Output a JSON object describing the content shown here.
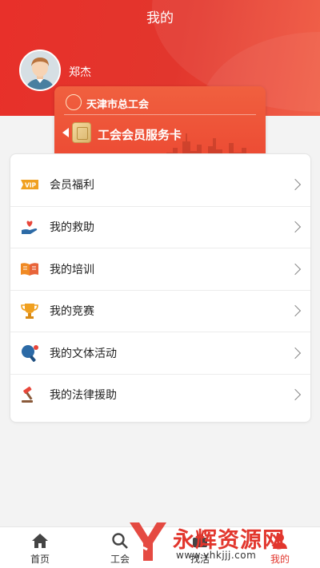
{
  "header": {
    "title": "我的"
  },
  "user": {
    "name": "郑杰"
  },
  "card": {
    "org": "天津市总工会",
    "title": "工会会员服务卡"
  },
  "menu": [
    {
      "label": "会员福利",
      "icon": "vip-badge-icon"
    },
    {
      "label": "我的救助",
      "icon": "hand-heart-icon"
    },
    {
      "label": "我的培训",
      "icon": "open-book-icon"
    },
    {
      "label": "我的竞赛",
      "icon": "trophy-icon"
    },
    {
      "label": "我的文体活动",
      "icon": "ping-pong-icon"
    },
    {
      "label": "我的法律援助",
      "icon": "gavel-icon"
    }
  ],
  "tabbar": [
    {
      "label": "首页",
      "icon": "home-icon"
    },
    {
      "label": "工会",
      "icon": "search-icon"
    },
    {
      "label": "找活",
      "icon": "work-icon"
    },
    {
      "label": "我的",
      "icon": "user-icon",
      "active": true
    }
  ],
  "watermark": {
    "title": "永辉资源网",
    "url": "www.yhkjjj.com"
  },
  "colors": {
    "brand_red": "#e2362d",
    "card_red": "#ec4a33",
    "icon_orange": "#f0a020"
  }
}
